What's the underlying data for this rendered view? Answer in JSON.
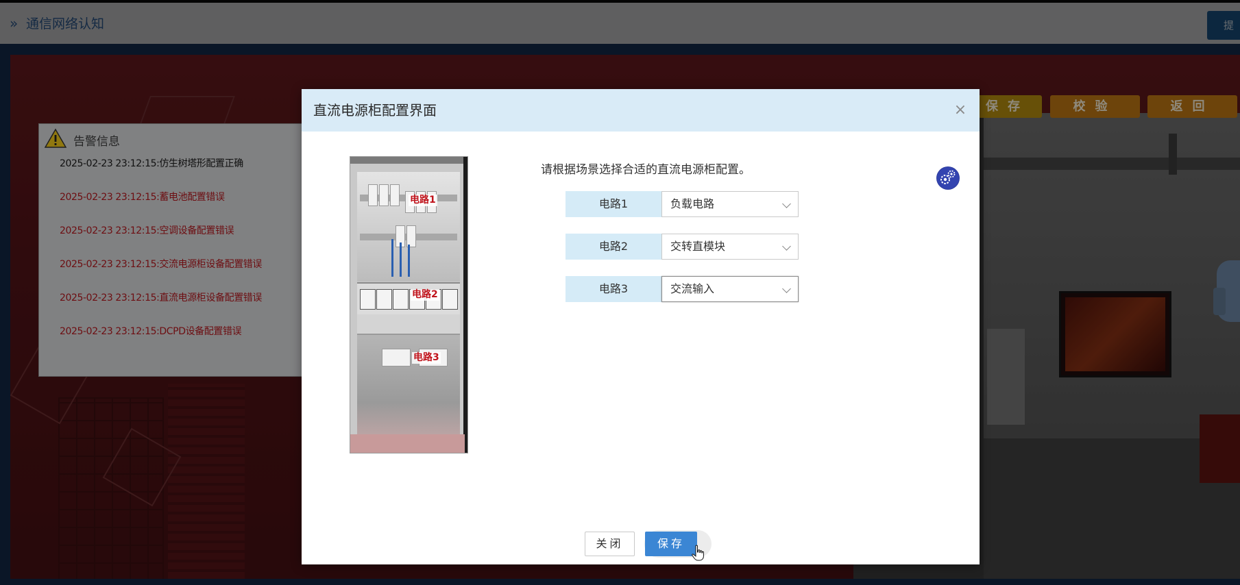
{
  "app": {
    "title": "通信网络认知",
    "submit_label": "提"
  },
  "scene_toolbar": {
    "save_label": "保存",
    "check_label": "校验",
    "back_label": "返回"
  },
  "alarm_panel": {
    "title": "告警信息",
    "items": [
      {
        "text": "2025-02-23 23:12:15:仿生树塔形配置正确",
        "status": "ok"
      },
      {
        "text": "2025-02-23 23:12:15:蓄电池配置错误",
        "status": "error"
      },
      {
        "text": "2025-02-23 23:12:15:空调设备配置错误",
        "status": "error"
      },
      {
        "text": "2025-02-23 23:12:15:交流电源柜设备配置错误",
        "status": "error"
      },
      {
        "text": "2025-02-23 23:12:15:直流电源柜设备配置错误",
        "status": "error"
      },
      {
        "text": "2025-02-23 23:12:15:DCPD设备配置错误",
        "status": "error"
      }
    ]
  },
  "dialog": {
    "title": "直流电源柜配置界面",
    "close_icon": "×",
    "instruction": "请根据场景选择合适的直流电源柜配置。",
    "cabinet_tags": [
      "电路1",
      "电路2",
      "电路3"
    ],
    "rows": [
      {
        "label": "电路1",
        "value": "负载电路"
      },
      {
        "label": "电路2",
        "value": "交转直模块"
      },
      {
        "label": "电路3",
        "value": "交流输入"
      }
    ],
    "close_button": "关闭",
    "save_button": "保存"
  },
  "colors": {
    "header_bg": "#d9ebf7",
    "label_bg": "#d5ebf7",
    "primary": "#3b86d4",
    "error_text": "#b0181e"
  }
}
